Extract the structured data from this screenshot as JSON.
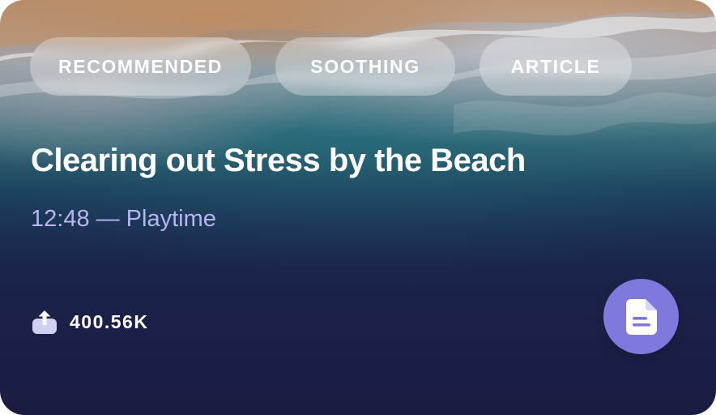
{
  "tags": [
    {
      "label": "RECOMMENDED"
    },
    {
      "label": "SOOTHING"
    },
    {
      "label": "ARTICLE"
    }
  ],
  "card": {
    "title": "Clearing out Stress by the Beach",
    "subtitle": "12:48 — Playtime",
    "share_count": "400.56K",
    "share_icon": "share-upload-icon",
    "action_icon": "document-icon"
  },
  "colors": {
    "subtitle": "#b7b4f2",
    "action_button": "#7f78dd",
    "share_icon": "#cfd0f3"
  }
}
